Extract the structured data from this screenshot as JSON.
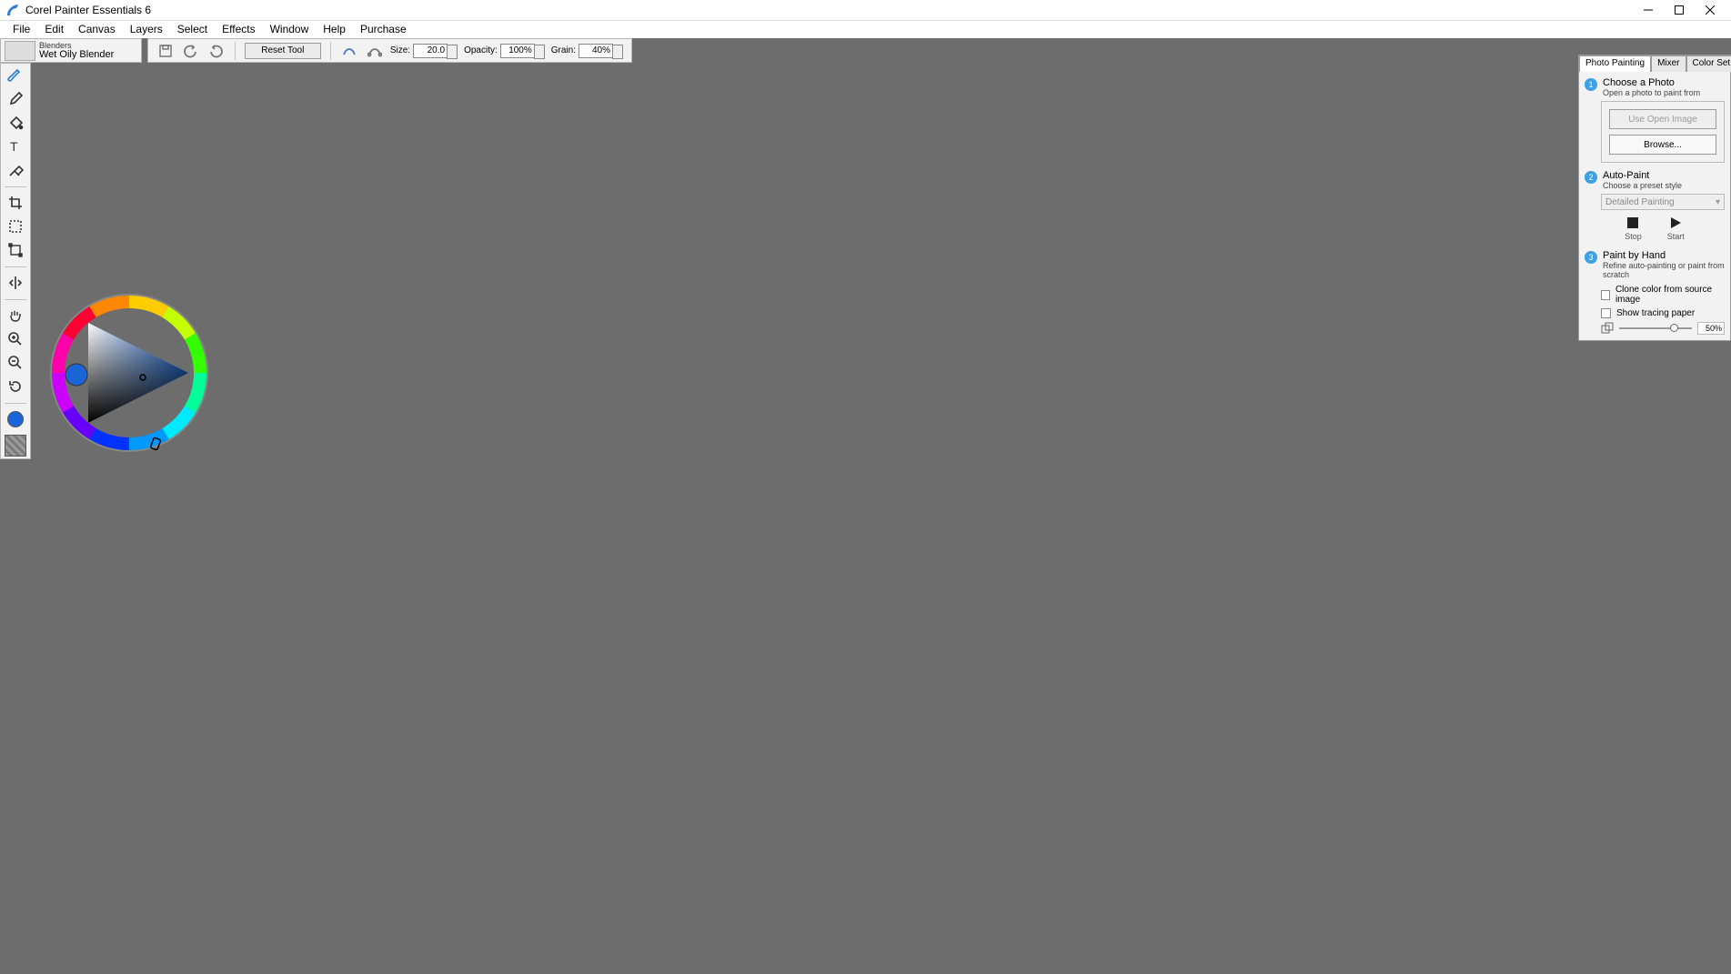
{
  "app": {
    "title": "Corel Painter Essentials 6"
  },
  "menus": [
    "File",
    "Edit",
    "Canvas",
    "Layers",
    "Select",
    "Effects",
    "Window",
    "Help",
    "Purchase"
  ],
  "brush": {
    "category": "Blenders",
    "name": "Wet Oily Blender"
  },
  "options": {
    "reset": "Reset Tool",
    "size_label": "Size:",
    "size": "20.0",
    "opacity_label": "Opacity:",
    "opacity": "100%",
    "grain_label": "Grain:",
    "grain": "40%"
  },
  "tools": [
    "brush",
    "dropper",
    "paintbucket",
    "text",
    "eraser",
    "crop",
    "selection",
    "transform",
    "mirror",
    "grabber",
    "magnifier-plus",
    "magnifier-minus",
    "rotate"
  ],
  "panel": {
    "tabs": [
      "Photo Painting",
      "Mixer",
      "Color Set"
    ],
    "active_tab": 0,
    "step1": {
      "title": "Choose a Photo",
      "sub": "Open a photo to paint from",
      "btn_open": "Use Open Image",
      "btn_browse": "Browse..."
    },
    "step2": {
      "title": "Auto-Paint",
      "sub": "Choose a preset style",
      "preset": "Detailed Painting",
      "stop": "Stop",
      "start": "Start"
    },
    "step3": {
      "title": "Paint by Hand",
      "sub": "Refine auto-painting or paint from scratch",
      "clone": "Clone color from source image",
      "tracing": "Show tracing paper",
      "tracing_pct": "50%"
    }
  }
}
